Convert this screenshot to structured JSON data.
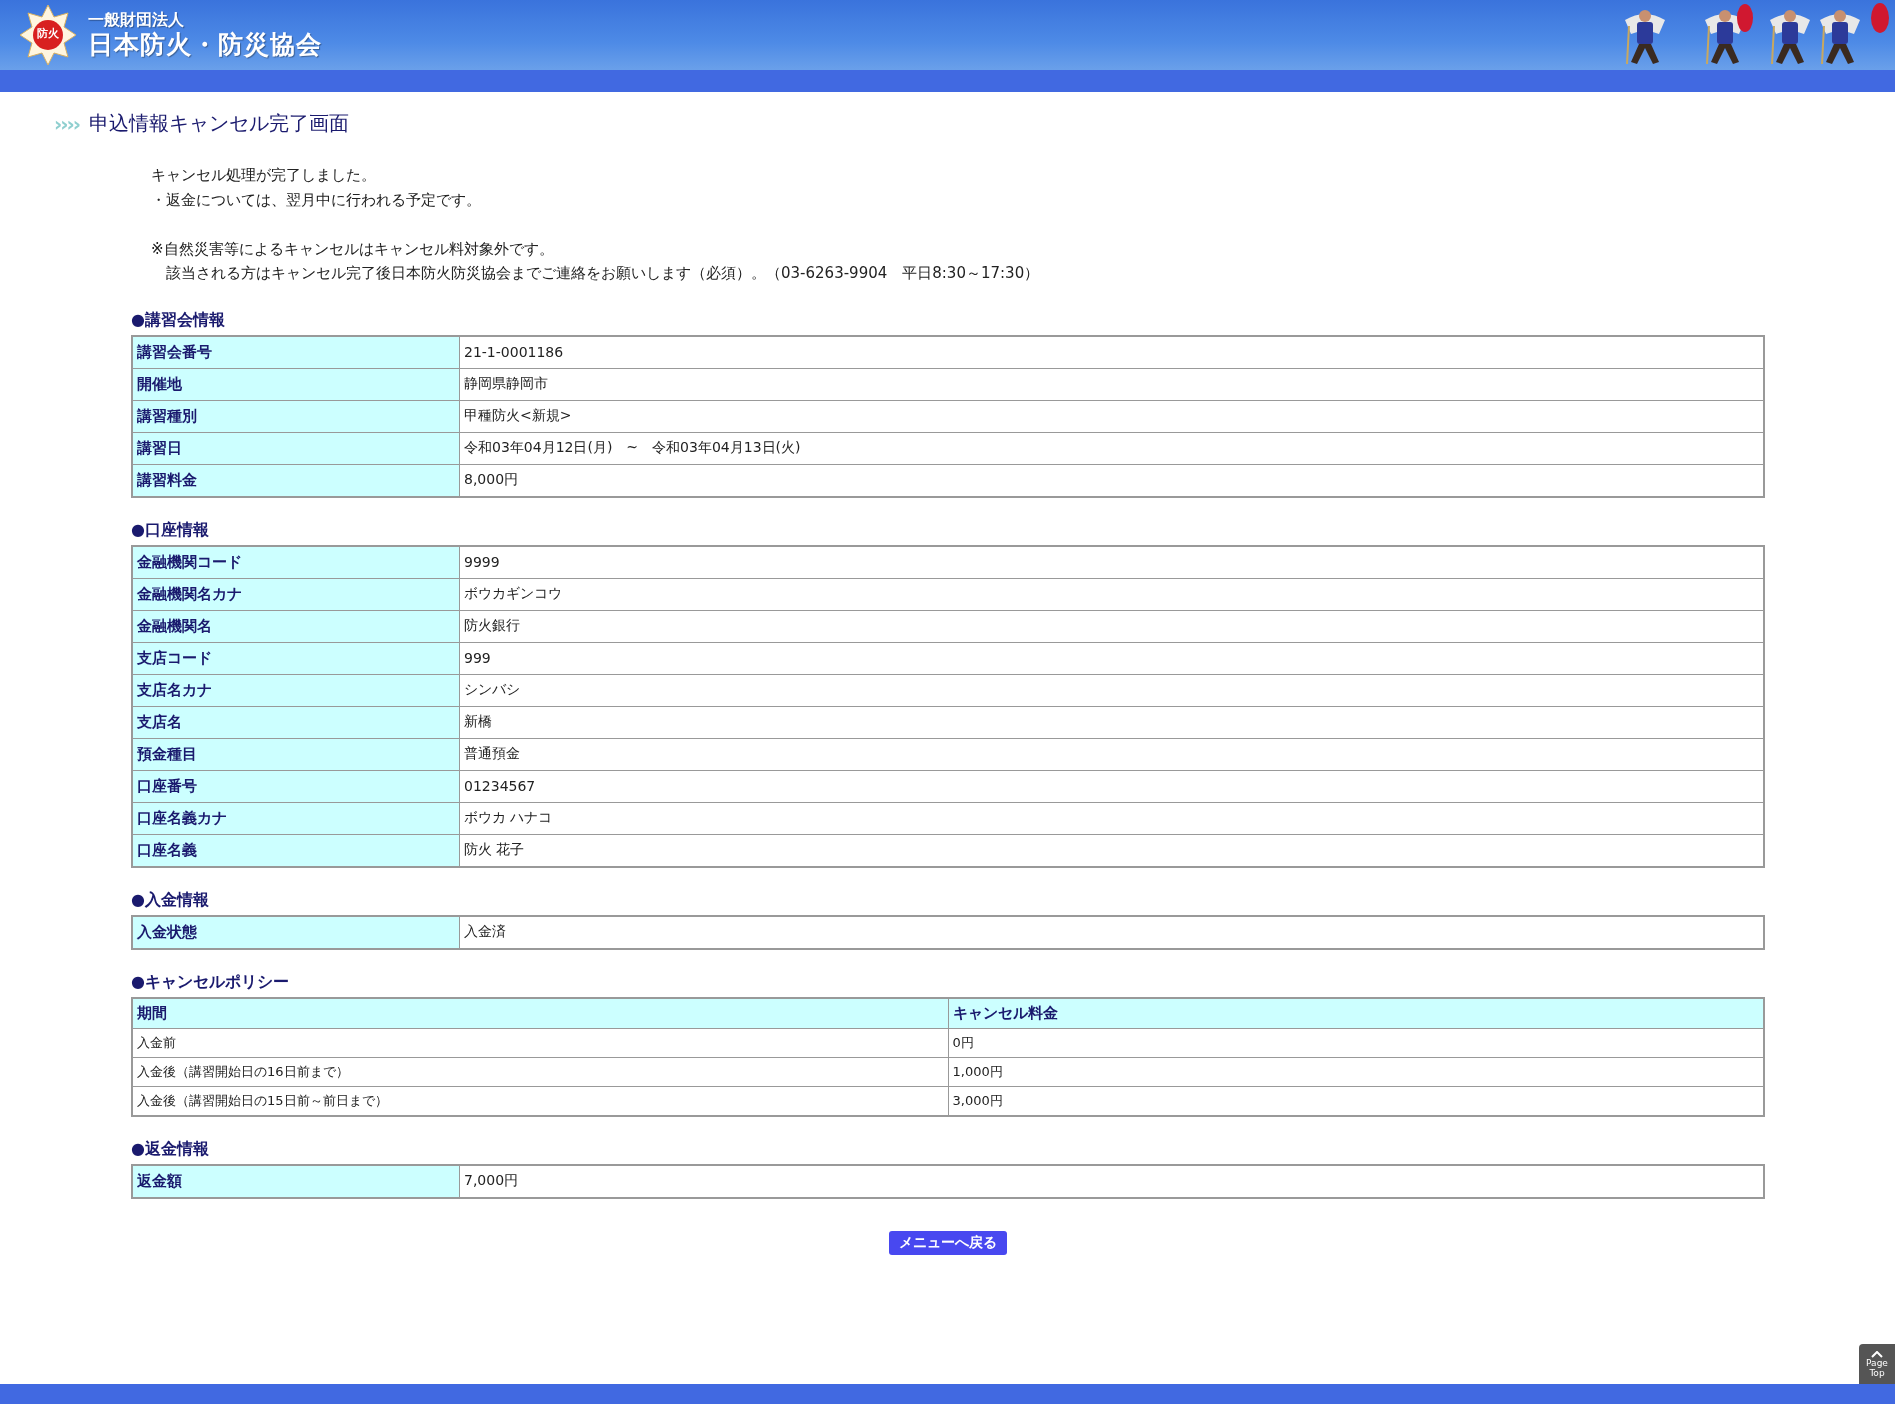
{
  "header": {
    "logo_text": "防火",
    "org_type": "一般財団法人",
    "org_name": "日本防火・防災協会"
  },
  "page_title": {
    "marker": "››››",
    "text": "申込情報キャンセル完了画面"
  },
  "messages": [
    [
      "キャンセル処理が完了しました。",
      "・返金については、翌月中に行われる予定です。"
    ],
    [
      "※自然災害等によるキャンセルはキャンセル料対象外です。",
      "　該当される方はキャンセル完了後日本防火防災協会までご連絡をお願いします（必須）。（03-6263-9904　平日8:30～17:30）"
    ]
  ],
  "sections": [
    {
      "kind": "kv",
      "heading": "●講習会情報",
      "rows": [
        {
          "label": "講習会番号",
          "value": "21-1-0001186"
        },
        {
          "label": "開催地",
          "value": "静岡県静岡市"
        },
        {
          "label": "講習種別",
          "value": "甲種防火<新規>"
        },
        {
          "label": "講習日",
          "value": "令和03年04月12日(月)　~　令和03年04月13日(火)"
        },
        {
          "label": "講習料金",
          "value": "8,000円"
        }
      ]
    },
    {
      "kind": "kv",
      "heading": "●口座情報",
      "rows": [
        {
          "label": "金融機関コード",
          "value": "9999"
        },
        {
          "label": "金融機関名カナ",
          "value": "ボウカギンコウ"
        },
        {
          "label": "金融機関名",
          "value": "防火銀行"
        },
        {
          "label": "支店コード",
          "value": "999"
        },
        {
          "label": "支店名カナ",
          "value": "シンバシ"
        },
        {
          "label": "支店名",
          "value": "新橋"
        },
        {
          "label": "預金種目",
          "value": "普通預金"
        },
        {
          "label": "口座番号",
          "value": "01234567"
        },
        {
          "label": "口座名義カナ",
          "value": "ボウカ ハナコ"
        },
        {
          "label": "口座名義",
          "value": "防火 花子"
        }
      ]
    },
    {
      "kind": "kv",
      "heading": "●入金情報",
      "rows": [
        {
          "label": "入金状態",
          "value": "入金済"
        }
      ]
    },
    {
      "kind": "policy",
      "heading": "●キャンセルポリシー",
      "columns": [
        "期間",
        "キャンセル料金"
      ],
      "rows": [
        [
          "入金前",
          "0円"
        ],
        [
          "入金後（講習開始日の16日前まで）",
          "1,000円"
        ],
        [
          "入金後（講習開始日の15日前～前日まで）",
          "3,000円"
        ]
      ]
    },
    {
      "kind": "kv",
      "heading": "●返金情報",
      "rows": [
        {
          "label": "返金額",
          "value": "7,000円"
        }
      ]
    }
  ],
  "back_button": "メニューへ戻る",
  "page_top": [
    "Page",
    "Top"
  ]
}
